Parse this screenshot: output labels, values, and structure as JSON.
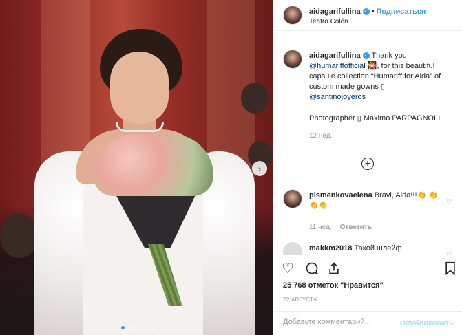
{
  "post": {
    "username": "aidagarifullina",
    "follow_label": "Подписаться",
    "location": "Teatro Colón",
    "dot": "•"
  },
  "caption": {
    "username": "aidagarifullina",
    "line1": " Thank you ",
    "mention1": "@humariffofficial",
    "line2": " 🎇, for this beautiful capsule collection “Humariff for Aida” of custom made gowns ▯ ",
    "mention2": "@santinojoyeros",
    "photographer": "Photographer ▯ Maximo PARPAGNOLI",
    "time": "12 нед."
  },
  "comments": [
    {
      "username": "pismenkovaelena",
      "text": " Bravi, Aida!!!👏 👏👏👏",
      "time": "11 нед.",
      "reply_label": "Ответить"
    },
    {
      "username": "makkm2018",
      "text": " Такой шлейф",
      "time": "",
      "reply_label": ""
    }
  ],
  "likes_text": "25 768 отметок \"Нравится\"",
  "date_text": "22 АВГУСТА",
  "add_comment": {
    "placeholder": "Добавьте комментарий...",
    "publish_label": "Опубликовать"
  },
  "icons": {
    "verified": "verified-badge",
    "heart": "heart-icon",
    "comment": "comment-icon",
    "share": "share-icon",
    "bookmark": "bookmark-icon",
    "next": "chevron-right-icon",
    "load_more": "plus-circle-icon"
  },
  "colors": {
    "accent": "#3897f0",
    "publish_disabled": "#b2dffc",
    "muted": "#999999"
  }
}
